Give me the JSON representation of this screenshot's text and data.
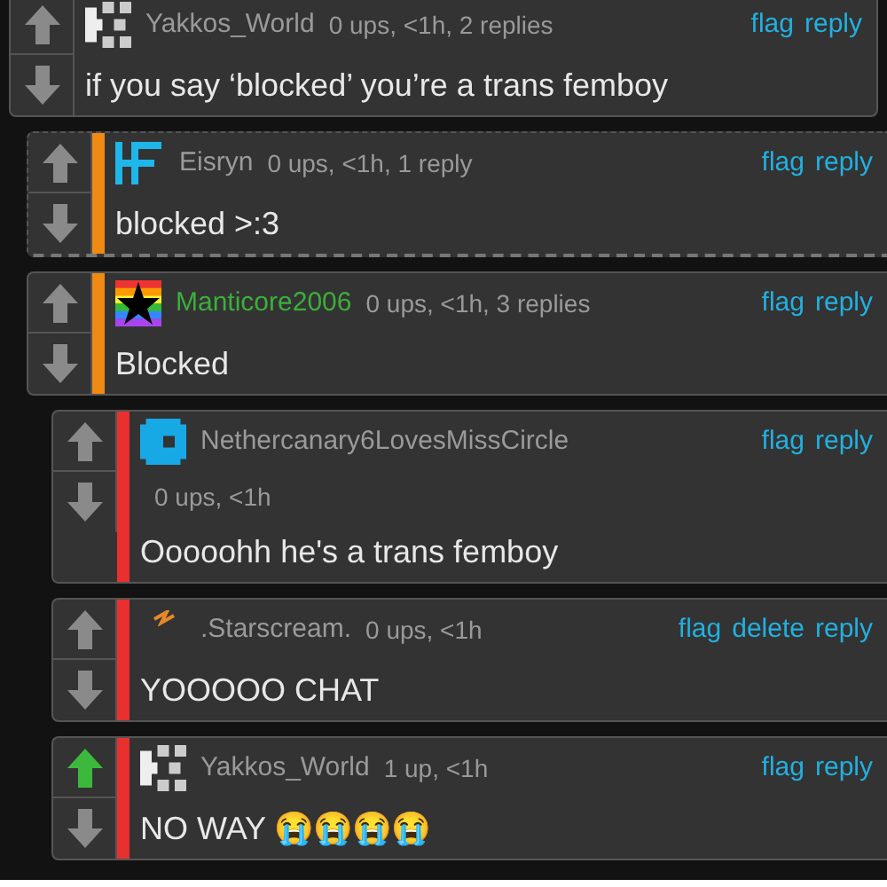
{
  "comments": [
    {
      "kind": "pixel",
      "username": "Yakkos_World",
      "color": "#9a9a9a",
      "meta": "0 ups, <1h, 2 replies",
      "actions": [
        "flag",
        "reply"
      ],
      "upvoted": false,
      "hidden_replies": false,
      "text": "if you say ‘blocked’ you’re a trans femboy",
      "children": [
        {
          "kind": "hf",
          "username": "Eisryn",
          "color": "#9a9a9a",
          "meta": "0 ups, <1h, 1 reply",
          "actions": [
            "flag",
            "reply"
          ],
          "upvoted": false,
          "hidden_replies": true,
          "text": "blocked >:3"
        },
        {
          "kind": "star",
          "username": "Manticore2006",
          "color": "#3cae3c",
          "meta": "0 ups, <1h, 3 replies",
          "actions": [
            "flag",
            "reply"
          ],
          "upvoted": false,
          "hidden_replies": false,
          "text": "Blocked",
          "children": [
            {
              "kind": "block",
              "username": "Nethercanary6LovesMissCircle",
              "color": "#9a9a9a",
              "meta": "0 ups, <1h",
              "actions": [
                "flag",
                "reply"
              ],
              "upvoted": false,
              "hidden_replies": false,
              "text": "Ooooohh he's a trans femboy"
            },
            {
              "kind": "bolt",
              "username": ".Starscream.",
              "color": "#9a9a9a",
              "meta": "0 ups, <1h",
              "actions": [
                "flag",
                "delete",
                "reply"
              ],
              "upvoted": false,
              "hidden_replies": false,
              "text": "YOOOOO CHAT"
            },
            {
              "kind": "pixel",
              "username": "Yakkos_World",
              "color": "#9a9a9a",
              "meta": "1 up, <1h",
              "actions": [
                "flag",
                "reply"
              ],
              "upvoted": true,
              "hidden_replies": false,
              "text": "NO WAY 😭😭😭😭"
            }
          ]
        }
      ]
    }
  ]
}
